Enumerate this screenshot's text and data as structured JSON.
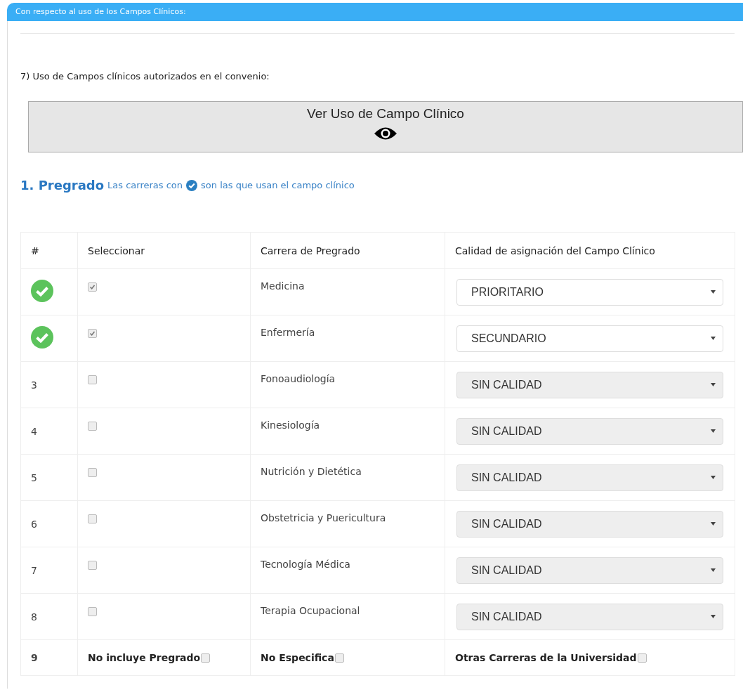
{
  "panel": {
    "title": "Con respecto al uso de los Campos Clínicos:"
  },
  "question": "7) Uso de Campos clínicos autorizados en el convenio:",
  "view_button": {
    "label": "Ver Uso de Campo Clínico"
  },
  "section": {
    "title": "1. Pregrado",
    "note_before": "Las carreras con",
    "note_after": "son las que usan el campo clínico"
  },
  "table": {
    "columns": [
      "#",
      "Seleccionar",
      "Carrera de Pregrado",
      "Calidad de asignación del Campo Clínico"
    ],
    "rows": [
      {
        "used": true,
        "checked": true,
        "career": "Medicina",
        "quality": "PRIORITARIO",
        "disabled": false
      },
      {
        "used": true,
        "checked": true,
        "career": "Enfermería",
        "quality": "SECUNDARIO",
        "disabled": false
      },
      {
        "used": false,
        "number": "3",
        "checked": false,
        "career": "Fonoaudiología",
        "quality": "SIN CALIDAD",
        "disabled": true
      },
      {
        "used": false,
        "number": "4",
        "checked": false,
        "career": "Kinesiología",
        "quality": "SIN CALIDAD",
        "disabled": true
      },
      {
        "used": false,
        "number": "5",
        "checked": false,
        "career": "Nutrición y Dietética",
        "quality": "SIN CALIDAD",
        "disabled": true
      },
      {
        "used": false,
        "number": "6",
        "checked": false,
        "career": "Obstetricia y Puericultura",
        "quality": "SIN CALIDAD",
        "disabled": true
      },
      {
        "used": false,
        "number": "7",
        "checked": false,
        "career": "Tecnología Médica",
        "quality": "SIN CALIDAD",
        "disabled": true
      },
      {
        "used": false,
        "number": "8",
        "checked": false,
        "career": "Terapia Ocupacional",
        "quality": "SIN CALIDAD",
        "disabled": true
      }
    ],
    "footer": {
      "number": "9",
      "options": [
        {
          "label": "No incluye Pregrado",
          "checked": false
        },
        {
          "label": "No Especifica",
          "checked": false
        },
        {
          "label": "Otras Carreras de la Universidad",
          "checked": false
        }
      ]
    }
  }
}
